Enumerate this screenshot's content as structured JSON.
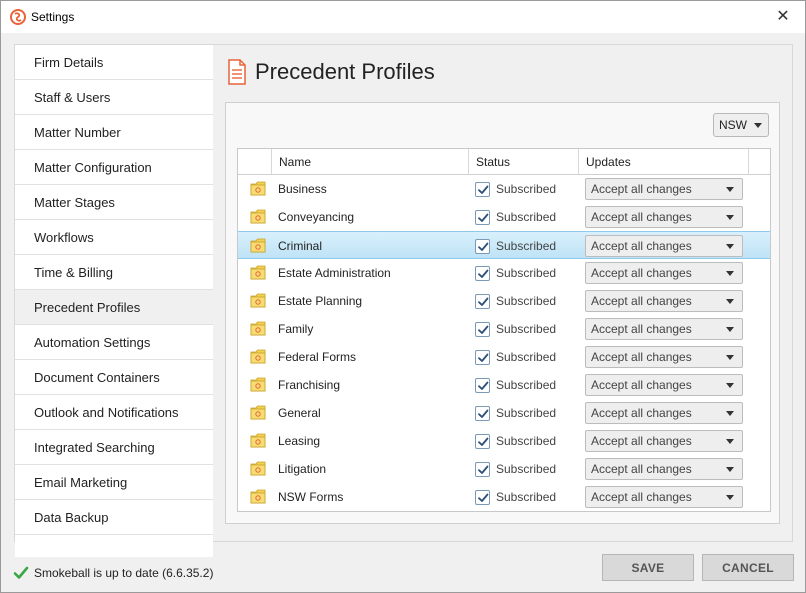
{
  "window": {
    "title": "Settings",
    "close_glyph": "✕"
  },
  "sidebar": {
    "items": [
      {
        "label": "Firm Details"
      },
      {
        "label": "Staff & Users"
      },
      {
        "label": "Matter Number"
      },
      {
        "label": "Matter Configuration"
      },
      {
        "label": "Matter Stages"
      },
      {
        "label": "Workflows"
      },
      {
        "label": "Time & Billing"
      },
      {
        "label": "Precedent Profiles"
      },
      {
        "label": "Automation Settings"
      },
      {
        "label": "Document Containers"
      },
      {
        "label": "Outlook and Notifications"
      },
      {
        "label": "Integrated Searching"
      },
      {
        "label": "Email Marketing"
      },
      {
        "label": "Data Backup"
      }
    ],
    "active_index": 7
  },
  "main": {
    "page_title": "Precedent Profiles",
    "region": "NSW",
    "columns": {
      "name": "Name",
      "status": "Status",
      "updates": "Updates"
    },
    "selected_row": 2,
    "rows": [
      {
        "name": "Business",
        "status": "Subscribed",
        "subscribed": true,
        "updates": "Accept all changes"
      },
      {
        "name": "Conveyancing",
        "status": "Subscribed",
        "subscribed": true,
        "updates": "Accept all changes"
      },
      {
        "name": "Criminal",
        "status": "Subscribed",
        "subscribed": true,
        "updates": "Accept all changes"
      },
      {
        "name": "Estate Administration",
        "status": "Subscribed",
        "subscribed": true,
        "updates": "Accept all changes"
      },
      {
        "name": "Estate Planning",
        "status": "Subscribed",
        "subscribed": true,
        "updates": "Accept all changes"
      },
      {
        "name": "Family",
        "status": "Subscribed",
        "subscribed": true,
        "updates": "Accept all changes"
      },
      {
        "name": "Federal Forms",
        "status": "Subscribed",
        "subscribed": true,
        "updates": "Accept all changes"
      },
      {
        "name": "Franchising",
        "status": "Subscribed",
        "subscribed": true,
        "updates": "Accept all changes"
      },
      {
        "name": "General",
        "status": "Subscribed",
        "subscribed": true,
        "updates": "Accept all changes"
      },
      {
        "name": "Leasing",
        "status": "Subscribed",
        "subscribed": true,
        "updates": "Accept all changes"
      },
      {
        "name": "Litigation",
        "status": "Subscribed",
        "subscribed": true,
        "updates": "Accept all changes"
      },
      {
        "name": "NSW Forms",
        "status": "Subscribed",
        "subscribed": true,
        "updates": "Accept all changes"
      }
    ]
  },
  "footer": {
    "status_text": "Smokeball is up to date (6.6.35.2)",
    "save_label": "SAVE",
    "cancel_label": "CANCEL"
  },
  "colors": {
    "accent_orange": "#e8633a",
    "check_green": "#3aa745",
    "folder_yellow": "#f2cf55",
    "selection_blue": "#bfe3f6"
  }
}
